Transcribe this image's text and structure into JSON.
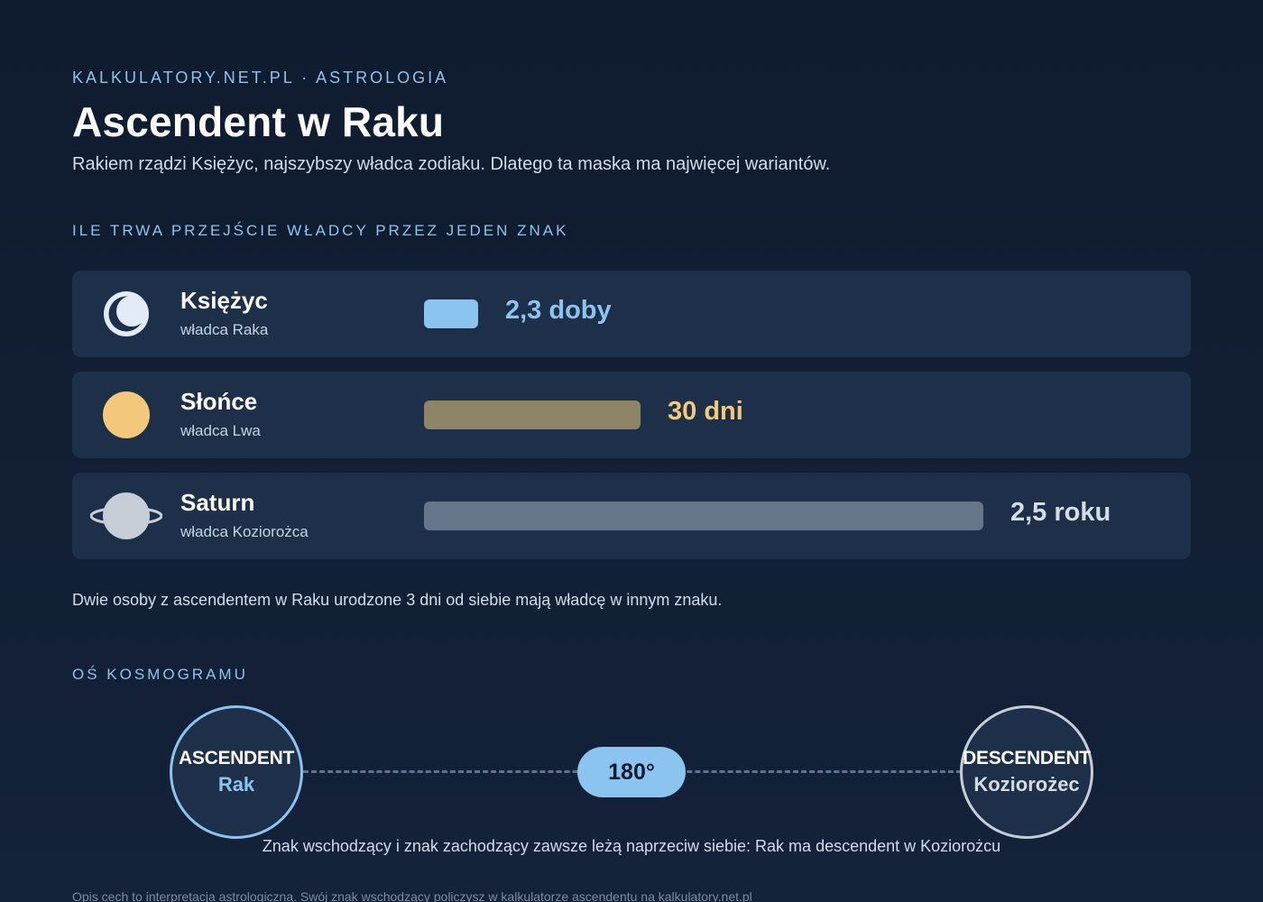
{
  "header": {
    "eyebrow": "KALKULATORY.NET.PL · ASTROLOGIA",
    "title": "Ascendent w Raku",
    "subtitle": "Rakiem rządzi Księżyc, najszybszy władca zodiaku. Dlatego ta maska ma najwięcej wariantów."
  },
  "transit": {
    "section_label": "ILE TRWA PRZEJŚCIE WŁADCY PRZEZ JEDEN ZNAK",
    "rows": [
      {
        "icon": "moon-icon",
        "name": "Księżyc",
        "role": "władca Raka",
        "value": "2,3 doby",
        "fill": 0.097,
        "bar_color": "#8cc4f0",
        "value_color": "#8cc4f0"
      },
      {
        "icon": "sun-icon",
        "name": "Słońce",
        "role": "władca Lwa",
        "value": "30 dni",
        "fill": 0.387,
        "bar_color": "#8e8566",
        "value_color": "#f2c97a"
      },
      {
        "icon": "saturn-icon",
        "name": "Saturn",
        "role": "władca Koziorożca",
        "value": "2,5 roku",
        "fill": 1.0,
        "bar_color": "#66758a",
        "value_color": "#d6dce4"
      }
    ],
    "note": "Dwie osoby z ascendentem w Raku urodzone 3 dni od siebie mają władcę w innym znaku."
  },
  "axis": {
    "section_label": "OŚ KOSMOGRAMU",
    "ascendant_label": "ASCENDENT",
    "ascendant_sign": "Rak",
    "descendant_label": "DESCENDENT",
    "descendant_sign": "Koziorożec",
    "degrees": "180°",
    "caption": "Znak wschodzący i znak zachodzący zawsze leżą naprzeciw siebie: Rak ma descendent w Koziorożcu"
  },
  "footer": "Opis cech to interpretacja astrologiczna. Swój znak wschodzący policzysz w kalkulatorze ascendentu na kalkulatory.net.pl",
  "colors": {
    "accent": "#8cc4f0",
    "sun": "#f2c97a",
    "saturn": "#c7ced8",
    "card": "#1e3049",
    "background": "#0f1b2e"
  }
}
